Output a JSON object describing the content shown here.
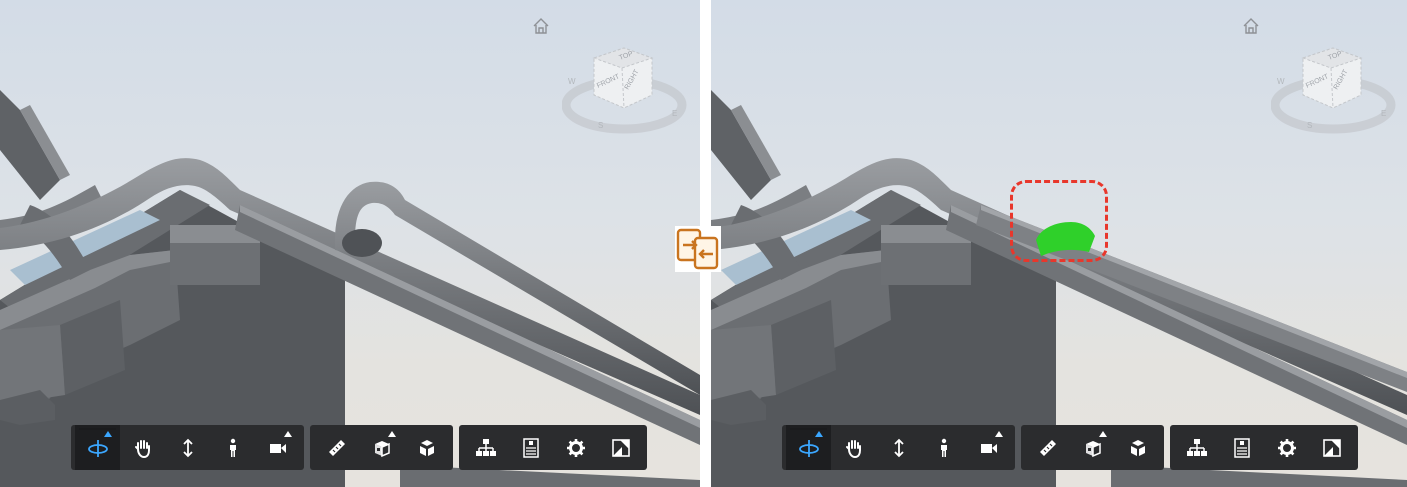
{
  "views": [
    {
      "id": "left",
      "nav_cube": {
        "top": "TOP",
        "front": "FRONT",
        "right": "RIGHT",
        "compass": [
          "W",
          "S",
          "E"
        ]
      },
      "toolbar": {
        "groups": [
          [
            {
              "name": "orbit",
              "icon": "orbit-icon",
              "active": true,
              "flyout": true
            },
            {
              "name": "pan",
              "icon": "hand-icon",
              "active": false,
              "flyout": false
            },
            {
              "name": "zoom",
              "icon": "updown-arrow-icon",
              "active": false,
              "flyout": false
            },
            {
              "name": "first-person",
              "icon": "person-icon",
              "active": false,
              "flyout": false
            },
            {
              "name": "camera",
              "icon": "video-camera-icon",
              "active": false,
              "flyout": true
            }
          ],
          [
            {
              "name": "measure",
              "icon": "ruler-icon",
              "active": false,
              "flyout": false
            },
            {
              "name": "section",
              "icon": "section-box-icon",
              "active": false,
              "flyout": true
            },
            {
              "name": "explode",
              "icon": "explode-cube-icon",
              "active": false,
              "flyout": false
            }
          ],
          [
            {
              "name": "model-browser",
              "icon": "hierarchy-icon",
              "active": false,
              "flyout": false
            },
            {
              "name": "properties",
              "icon": "properties-icon",
              "active": false,
              "flyout": false
            },
            {
              "name": "settings",
              "icon": "gear-icon",
              "active": false,
              "flyout": false
            },
            {
              "name": "fullscreen",
              "icon": "fullscreen-icon",
              "active": false,
              "flyout": false
            }
          ]
        ]
      }
    },
    {
      "id": "right",
      "nav_cube": {
        "top": "TOP",
        "front": "FRONT",
        "right": "RIGHT",
        "compass": [
          "W",
          "S",
          "E"
        ]
      },
      "highlight_color": "#e8372c",
      "changed_element_color": "#2fd02a"
    }
  ],
  "compare_icon": "compare-versions-icon",
  "colors": {
    "pipe": "#6f7276",
    "duct": "#66696d",
    "toolbar_bg": "#2b2c2e",
    "active_icon": "#3ba7ff"
  }
}
